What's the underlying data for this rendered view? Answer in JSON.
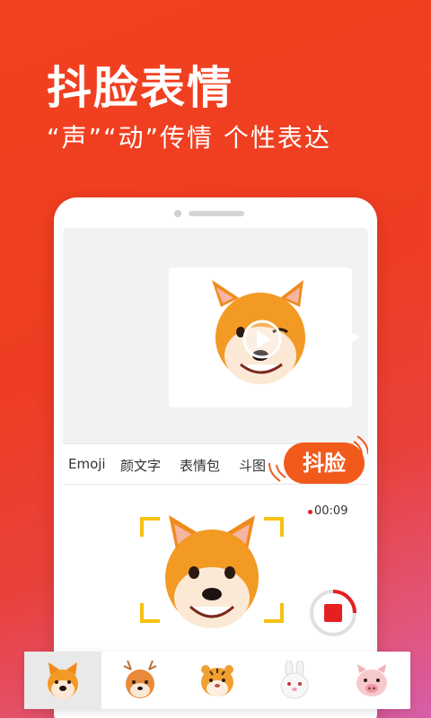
{
  "header": {
    "title": "抖脸表情",
    "subtitle": "“声”“动”传情  个性表达"
  },
  "keyboard": {
    "tabs": [
      "Emoji",
      "颜文字",
      "表情包",
      "斗图"
    ],
    "action_button": "抖脸"
  },
  "recorder": {
    "timer": "00:09",
    "progress": 0.25
  },
  "message": {
    "type": "animated-emoji-video",
    "character": "shiba-dog-icon"
  },
  "avatars": [
    "shiba-dog-icon",
    "deer-icon",
    "tiger-icon",
    "rabbit-icon",
    "pig-icon"
  ],
  "selected_avatar": 0,
  "colors": {
    "brand": "#f25a1c",
    "record": "#e52020",
    "frame": "#f5c211"
  }
}
